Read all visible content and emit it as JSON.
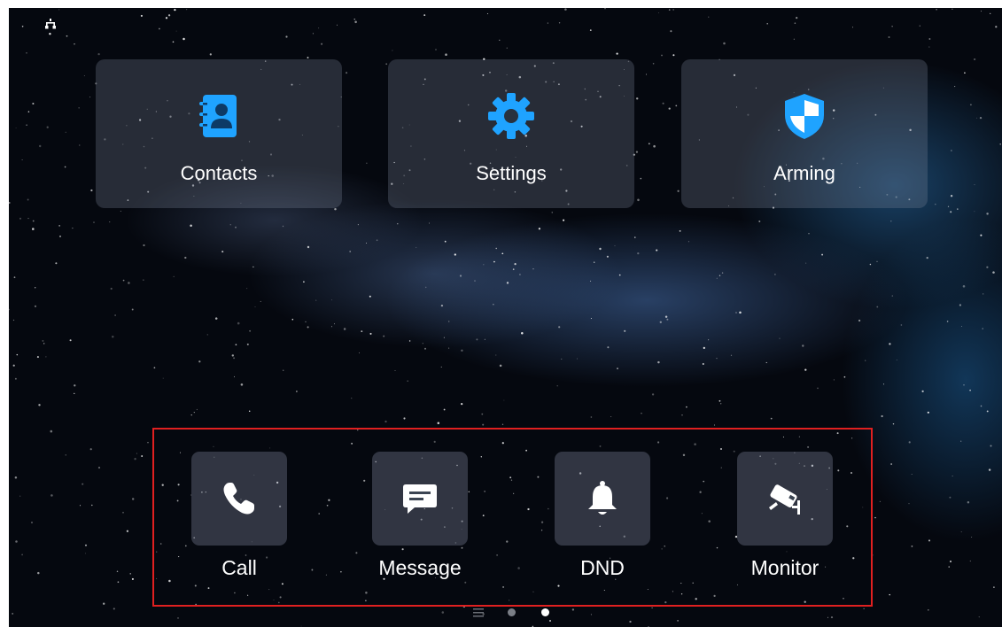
{
  "status_bar": {
    "network_icon": "network-icon"
  },
  "apps": [
    {
      "label": "Contacts",
      "icon": "contacts-icon",
      "color": "#1fa3ff"
    },
    {
      "label": "Settings",
      "icon": "gear-icon",
      "color": "#1fa3ff"
    },
    {
      "label": "Arming",
      "icon": "shield-icon",
      "color": "#1fa3ff"
    }
  ],
  "dock": [
    {
      "label": "Call",
      "icon": "phone-icon"
    },
    {
      "label": "Message",
      "icon": "message-icon"
    },
    {
      "label": "DND",
      "icon": "bell-icon"
    },
    {
      "label": "Monitor",
      "icon": "camera-icon"
    }
  ],
  "pager": {
    "pages": 2,
    "current_page": 2
  },
  "colors": {
    "accent": "#1fa3ff",
    "highlight_border": "#e02020",
    "background": "#05080f"
  }
}
